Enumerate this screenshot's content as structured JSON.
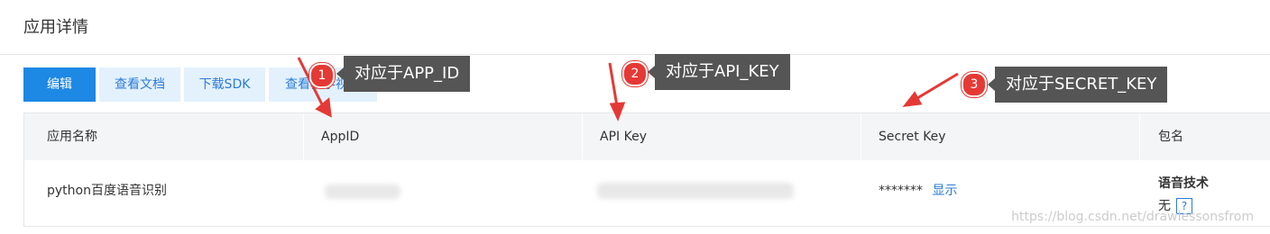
{
  "page": {
    "title": "应用详情"
  },
  "toolbar": {
    "edit": "编辑",
    "docs": "查看文档",
    "sdk": "下载SDK",
    "video": "查看教学视频"
  },
  "table": {
    "headers": [
      "应用名称",
      "AppID",
      "API Key",
      "Secret Key",
      "包名"
    ],
    "row": {
      "app_name": "python百度语音识别",
      "secret_masked": "*******",
      "show_link": "显示",
      "tech_title": "语音技术",
      "tech_value": "无",
      "help": "?"
    }
  },
  "annotations": [
    {
      "num": "1",
      "label": "对应于APP_ID"
    },
    {
      "num": "2",
      "label": "对应于API_KEY"
    },
    {
      "num": "3",
      "label": "对应于SECRET_KEY"
    }
  ],
  "watermark": "https://blog.csdn.net/drawlessonsfrom",
  "colors": {
    "accent": "#1e88e5",
    "annotation_red": "#e53935",
    "tooltip_bg": "#555555"
  }
}
